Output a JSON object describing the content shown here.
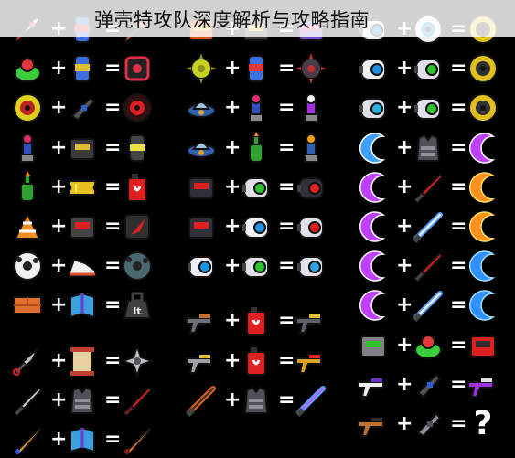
{
  "header": {
    "title": "弹壳特攻队深度解析与攻略指南"
  },
  "operators": {
    "plus": "+",
    "equals": "="
  },
  "unknown_result": "?",
  "columns": [
    {
      "rows": [
        [
          "rocket-icon",
          "drink-can-icon",
          "evolved-rocket-icon"
        ],
        [
          "green-orb-icon",
          "energy-cell-icon",
          "red-cube-icon"
        ],
        [
          "shield-disc-icon",
          "mech-arm-icon",
          "red-ring-icon"
        ],
        [
          "tesla-coil-icon",
          "ammo-pack-icon",
          "energy-canister-icon"
        ],
        [
          "molotov-icon",
          "gold-ticket-icon",
          "fuel-can-icon"
        ],
        [
          "drill-cone-icon",
          "spin-drone-icon",
          "red-shard-icon"
        ],
        [
          "soccer-ball-icon",
          "sneaker-icon",
          "dark-sphere-icon"
        ],
        [
          "brick-icon",
          "manual-book-icon",
          "weight-icon"
        ],
        [
          "kunai-icon",
          "scroll-icon",
          "shuriken-icon"
        ],
        [
          "katana-icon",
          "armor-vest-icon",
          "blood-blade-icon"
        ],
        [
          "baseball-bat-icon",
          "manual-book-icon",
          "spiked-bat-icon"
        ]
      ]
    },
    {
      "rows": [
        [
          "joystick-icon",
          "ammo-pack-icon",
          "arcade-bot-icon"
        ],
        [
          "durian-icon",
          "drink-can-icon",
          "spike-ball-icon"
        ],
        [
          "ufo-disc-icon",
          "tesla-coil-icon",
          "purple-tesla-icon"
        ],
        [
          "ufo-disc-icon",
          "molotov-icon",
          "lava-lamp-icon"
        ],
        [
          "turret-icon",
          "drone-plus-icon",
          "dark-turret-icon"
        ],
        [
          "turret-icon",
          "white-drone-icon",
          "cube-drone-icon"
        ],
        [
          "white-drone-icon",
          "drone-plus-icon",
          "drone-pod-icon"
        ],
        [
          "shotgun-icon",
          "fuel-can-icon",
          "minigun-icon"
        ],
        [
          "revolver-icon",
          "fuel-can-icon",
          "golden-revolver-icon"
        ],
        [
          "lightsaber-icon",
          "armor-vest-icon",
          "plasma-sword-icon"
        ]
      ]
    },
    {
      "rows": [
        [
          "white-drone-icon",
          "ring-icon",
          "yellow-coil-icon"
        ],
        [
          "white-drone-icon",
          "drone-plus-icon",
          "yellow-coil-icon"
        ],
        [
          "camera-drone-icon",
          "drone-plus-icon",
          "yellow-coil-icon"
        ],
        [
          "blue-boomerang-icon",
          "armor-vest-icon",
          "purple-crescent-icon"
        ],
        [
          "purple-crescent-icon",
          "red-dagger-icon",
          "orange-crescent-icon"
        ],
        [
          "purple-crescent-icon",
          "blue-laser-blade-icon",
          "orange-crescent-icon"
        ],
        [
          "purple-crescent-icon",
          "red-dagger-icon",
          "blue-crescent-icon"
        ],
        [
          "purple-crescent-icon",
          "blue-laser-blade-icon",
          "blue-crescent-icon"
        ],
        [
          "handheld-device-icon",
          "green-orb-icon",
          "chip-icon"
        ],
        [
          "laser-gun-icon",
          "mech-arm-icon",
          "purple-blaster-icon"
        ],
        [
          "ak-rifle-icon",
          "grey-tube-icon",
          "unknown"
        ]
      ]
    }
  ],
  "colors": {
    "background": "#000000",
    "title_bar": "#ffffff",
    "title_text": "#111111"
  }
}
